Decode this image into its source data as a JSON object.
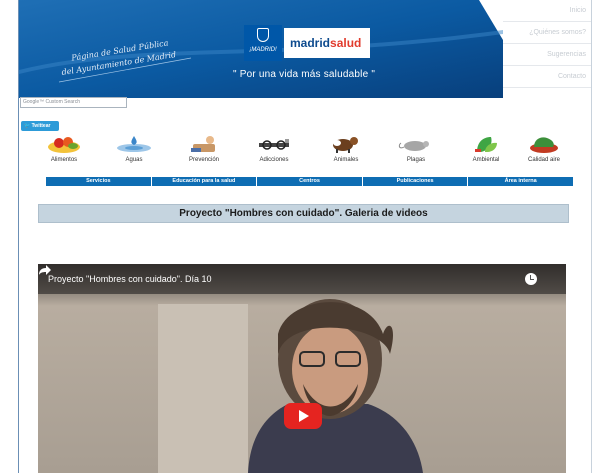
{
  "header": {
    "subtitle_line1": "Página de Salud Pública",
    "subtitle_line2": "del Ayuntamiento de Madrid",
    "logo_madrid": "¡MADRID!",
    "logo_brand_a": "madrid",
    "logo_brand_b": "salud",
    "tagline": "\" Por una vida más saludable \""
  },
  "top_menu": {
    "items": [
      {
        "label": "Inicio"
      },
      {
        "label": "¿Quiénes somos?"
      },
      {
        "label": "Sugerencias"
      },
      {
        "label": "Contacto"
      }
    ]
  },
  "search": {
    "placeholder": "Google™ Custom Search"
  },
  "twitter": {
    "label": "Twittear"
  },
  "categories": [
    {
      "label": "Alimentos",
      "icon": "food-icon"
    },
    {
      "label": "Aguas",
      "icon": "water-icon"
    },
    {
      "label": "Prevención",
      "icon": "prevention-icon"
    },
    {
      "label": "Adicciones",
      "icon": "addictions-icon"
    },
    {
      "label": "Animales",
      "icon": "animals-icon"
    },
    {
      "label": "Plagas",
      "icon": "pests-icon"
    },
    {
      "label": "Ambiental",
      "icon": "environment-icon"
    },
    {
      "label": "Calidad aire",
      "icon": "air-quality-icon"
    }
  ],
  "nav": {
    "items": [
      {
        "label": "Servicios"
      },
      {
        "label": "Educación para la salud"
      },
      {
        "label": "Centros"
      },
      {
        "label": "Publicaciones"
      },
      {
        "label": "Área interna"
      }
    ]
  },
  "page": {
    "title": "Proyecto \"Hombres con cuidado\". Galeria de videos"
  },
  "video": {
    "title": "Proyecto \"Hombres con cuidado\". Día 10"
  },
  "colors": {
    "banner_blue": "#0a5fa8",
    "nav_blue": "#0e6db3",
    "title_bar": "#c5d4df",
    "play_red": "#e52420"
  }
}
